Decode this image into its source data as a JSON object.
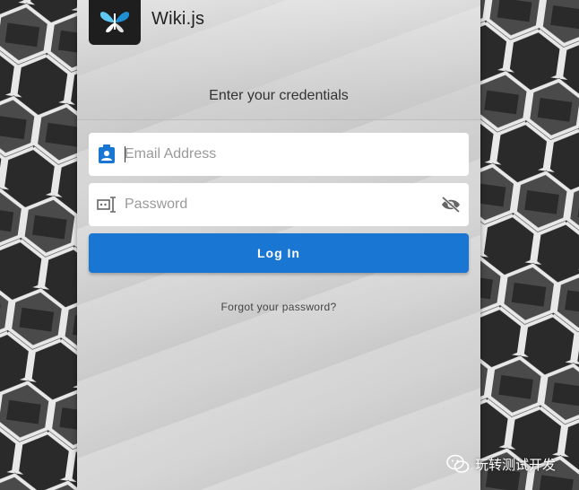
{
  "app": {
    "title": "Wiki.js"
  },
  "login": {
    "subtitle": "Enter your credentials",
    "email_placeholder": "Email Address",
    "password_placeholder": "Password",
    "login_label": "Log In",
    "forgot_label": "Forgot your password?"
  },
  "watermark": {
    "text": "玩转测试开发"
  },
  "icons": {
    "logo": "wikijs-logo",
    "email": "account-box-icon",
    "password": "textbox-password-icon",
    "visibility": "eye-off-icon",
    "watermark": "wechat-icon"
  },
  "colors": {
    "primary": "#1976d2",
    "logo_bg": "#1e1e1e"
  }
}
